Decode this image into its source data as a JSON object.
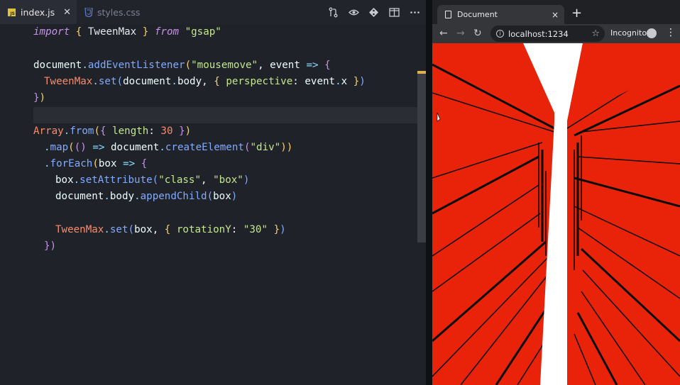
{
  "editor": {
    "tabs": [
      {
        "label": "index.js",
        "icon": "js-file-icon",
        "active": true
      },
      {
        "label": "styles.css",
        "icon": "css-file-icon",
        "active": false
      }
    ],
    "toolbar": [
      "source-control-icon",
      "preview-icon",
      "git-icon",
      "split-editor-icon",
      "more-icon"
    ],
    "code": {
      "l1": {
        "a": "import",
        "b": "{",
        "c": " TweenMax ",
        "d": "}",
        "e": "from",
        "f": "\"gsap\""
      },
      "l3": {
        "a": "document",
        "b": ".",
        "c": "addEventListener",
        "d": "(",
        "e": "\"mousemove\"",
        "f": ", ",
        "g": "event",
        "h": "=>",
        "i": "{"
      },
      "l4": {
        "a": "TweenMax",
        "b": ".",
        "c": "set",
        "d": "(",
        "e": "document",
        "f": ".",
        "g": "body",
        "h": ", ",
        "i": "{",
        "j": "perspective",
        "k": ": ",
        "l": "event",
        "m": ".",
        "n": "x",
        "o": "}",
        "p": ")"
      },
      "l5": {
        "a": "}",
        "b": ")"
      },
      "l7": {
        "a": "Array",
        "b": ".",
        "c": "from",
        "d": "(",
        "e": "{",
        "f": "length",
        "g": ": ",
        "h": "30",
        "i": "}",
        "j": ")"
      },
      "l8": {
        "a": ".",
        "b": "map",
        "c": "(",
        "d": "()",
        "e": "=>",
        "f": "document",
        "g": ".",
        "h": "createElement",
        "i": "(",
        "j": "\"div\"",
        "k": "))"
      },
      "l9": {
        "a": ".",
        "b": "forEach",
        "c": "(",
        "d": "box",
        "e": "=>",
        "f": "{"
      },
      "l10": {
        "a": "box",
        "b": ".",
        "c": "setAttribute",
        "d": "(",
        "e": "\"class\"",
        "f": ", ",
        "g": "\"box\"",
        "h": ")"
      },
      "l11": {
        "a": "document",
        "b": ".",
        "c": "body",
        "d": ".",
        "e": "appendChild",
        "f": "(",
        "g": "box",
        "h": ")"
      },
      "l13": {
        "a": "TweenMax",
        "b": ".",
        "c": "set",
        "d": "(",
        "e": "box",
        "f": ", ",
        "g": "{",
        "h": "rotationY",
        "i": ": ",
        "j": "\"30\"",
        "k": "}",
        "l": ")"
      },
      "l14": {
        "a": "})"
      }
    }
  },
  "browser": {
    "tab_title": "Document",
    "tab_close": "×",
    "new_tab": "+",
    "url": "localhost:1234",
    "incognito_label": "Incognito",
    "nav": {
      "back": "←",
      "forward": "→",
      "reload": "↻",
      "menu": "⋮",
      "star": "☆"
    },
    "page_background": "#e8230a",
    "stripe_color": "#0a0a0a"
  },
  "colors": {
    "editor_bg": "#1f2228",
    "accent": "#e0b24b"
  }
}
